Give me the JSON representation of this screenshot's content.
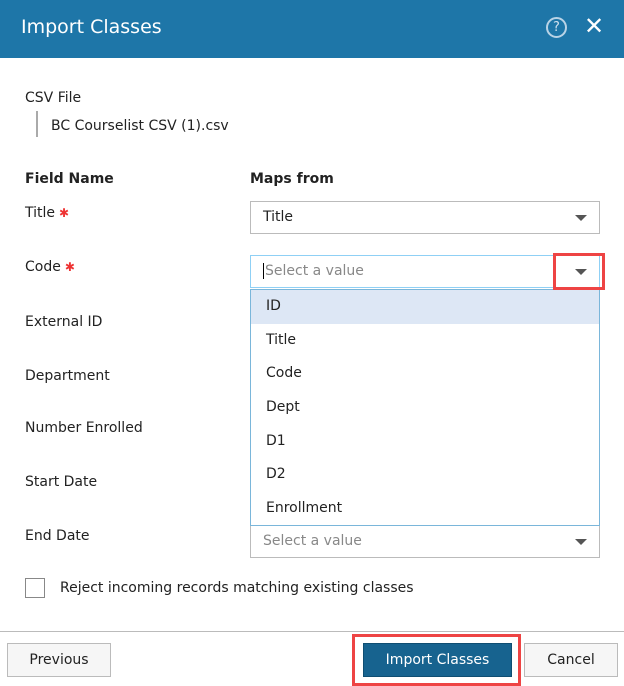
{
  "header": {
    "title": "Import Classes",
    "help_icon": "question-circle-icon",
    "close_icon": "close-x-icon"
  },
  "csv": {
    "label": "CSV File",
    "file": "BC Courselist CSV (1).csv"
  },
  "columns": {
    "field": "Field Name",
    "maps": "Maps from"
  },
  "fields": [
    {
      "label": "Title",
      "required": true,
      "value": "Title"
    },
    {
      "label": "Code",
      "required": true,
      "placeholder": "Select a value"
    },
    {
      "label": "External ID"
    },
    {
      "label": "Department"
    },
    {
      "label": "Number Enrolled"
    },
    {
      "label": "Start Date"
    },
    {
      "label": "End Date",
      "placeholder": "Select a value"
    }
  ],
  "required_mark": "✱",
  "dropdown_options": [
    "ID",
    "Title",
    "Code",
    "Dept",
    "D1",
    "D2",
    "Enrollment"
  ],
  "reject": {
    "label": "Reject incoming records matching existing classes",
    "checked": false
  },
  "buttons": {
    "previous": "Previous",
    "import": "Import Classes",
    "cancel": "Cancel"
  },
  "colors": {
    "header": "#1e76a8",
    "primary": "#17638f",
    "highlight": "#ee4444"
  }
}
